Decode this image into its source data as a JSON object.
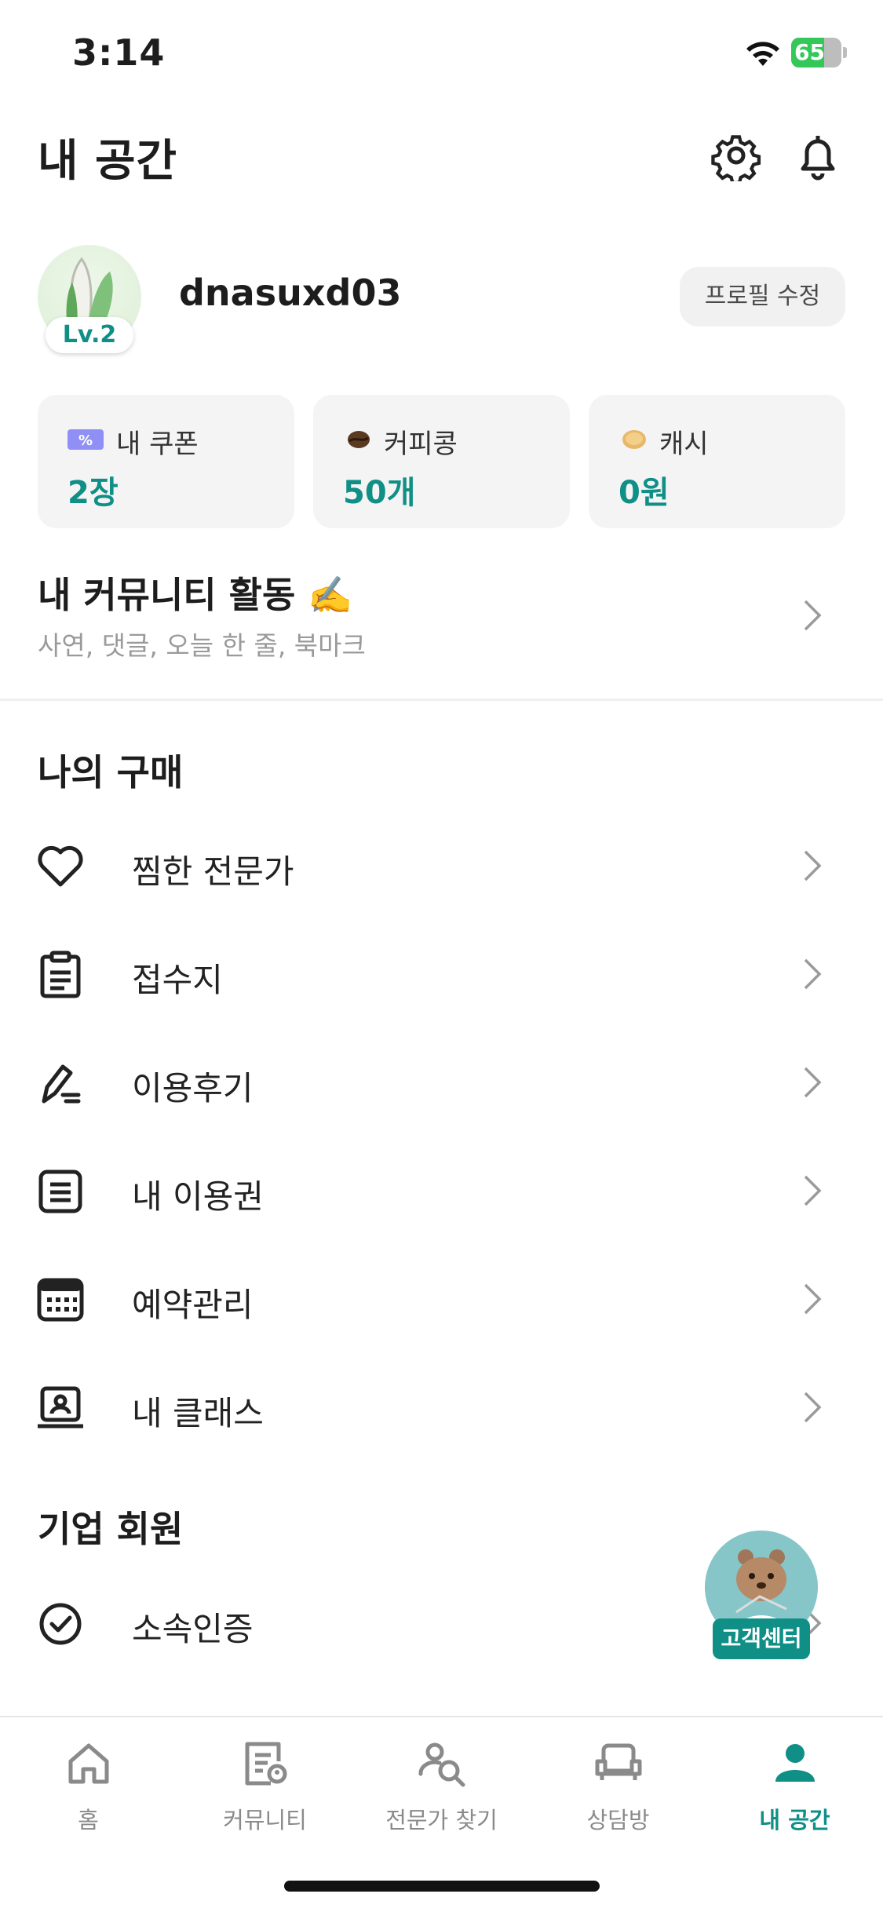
{
  "status_bar": {
    "time": "3:14",
    "battery": "65",
    "battery_level": 0.65
  },
  "header": {
    "title": "내 공간",
    "settings_icon": "gear-icon",
    "notification_icon": "bell-icon"
  },
  "profile": {
    "username": "dnasuxd03",
    "level": "Lv.2",
    "edit_label": "프로필 수정"
  },
  "stats": [
    {
      "icon": "coupon-icon",
      "label": "내 쿠폰",
      "value": "2장"
    },
    {
      "icon": "coffee-bean-icon",
      "label": "커피콩",
      "value": "50개"
    },
    {
      "icon": "coin-icon",
      "label": "캐시",
      "value": "0원"
    }
  ],
  "community": {
    "title": "내 커뮤니티 활동 ✍️",
    "subtitle": "사연, 댓글, 오늘 한 줄, 북마크"
  },
  "purchases": {
    "title": "나의 구매",
    "items": [
      {
        "icon": "heart-icon",
        "label": "찜한 전문가"
      },
      {
        "icon": "clipboard-icon",
        "label": "접수지"
      },
      {
        "icon": "pen-icon",
        "label": "이용후기"
      },
      {
        "icon": "document-icon",
        "label": "내 이용권"
      },
      {
        "icon": "calendar-icon",
        "label": "예약관리"
      },
      {
        "icon": "class-icon",
        "label": "내 클래스"
      }
    ]
  },
  "business": {
    "title": "기업 회원",
    "items": [
      {
        "icon": "check-circle-icon",
        "label": "소속인증"
      }
    ]
  },
  "customer_center": {
    "label": "고객센터"
  },
  "tabs": [
    {
      "icon": "home-icon",
      "label": "홈",
      "active": false
    },
    {
      "icon": "community-icon",
      "label": "커뮤니티",
      "active": false
    },
    {
      "icon": "expert-search-icon",
      "label": "전문가 찾기",
      "active": false
    },
    {
      "icon": "sofa-icon",
      "label": "상담방",
      "active": false
    },
    {
      "icon": "person-icon",
      "label": "내 공간",
      "active": true
    }
  ],
  "colors": {
    "accent": "#0f8f86",
    "card_bg": "#f4f4f4",
    "battery_green": "#34c759"
  }
}
